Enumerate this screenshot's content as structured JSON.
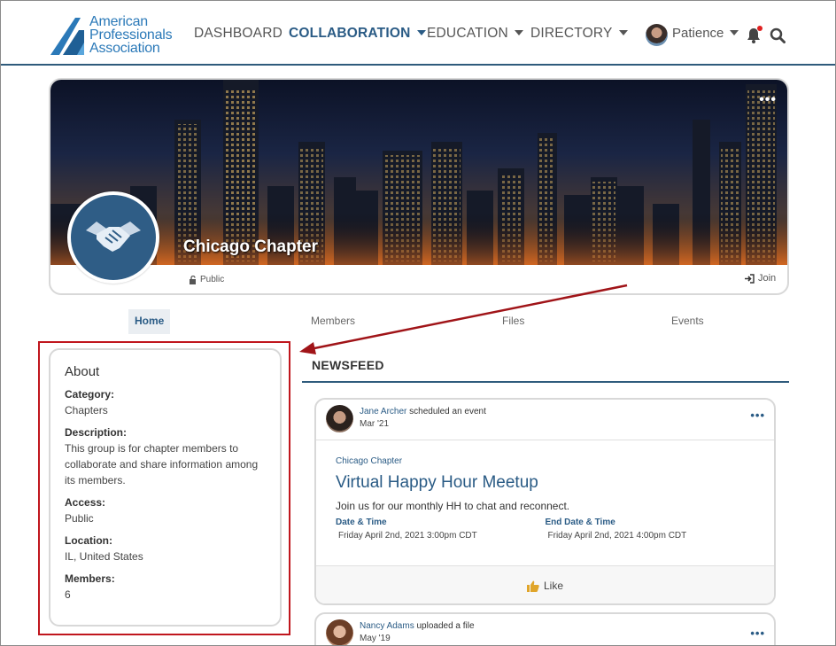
{
  "header": {
    "logo_lines": [
      "American",
      "Professionals",
      "Association"
    ],
    "nav": [
      {
        "label": "DASHBOARD",
        "has_caret": false
      },
      {
        "label": "COLLABORATION",
        "has_caret": true,
        "active": true
      },
      {
        "label": "EDUCATION",
        "has_caret": true
      },
      {
        "label": "DIRECTORY",
        "has_caret": true
      }
    ],
    "user_name": "Patience",
    "icons": [
      "bell-icon",
      "search-icon"
    ]
  },
  "group": {
    "title": "Chicago Chapter",
    "visibility": "Public",
    "join_label": "Join",
    "more_label": "•••"
  },
  "tabs": [
    {
      "label": "Home",
      "active": true
    },
    {
      "label": "Members"
    },
    {
      "label": "Files"
    },
    {
      "label": "Events"
    }
  ],
  "about": {
    "title": "About",
    "fields": [
      {
        "label": "Category:",
        "value": "Chapters"
      },
      {
        "label": "Description:",
        "value": "This group is for chapter members to collaborate and share information among its members."
      },
      {
        "label": "Access:",
        "value": "Public"
      },
      {
        "label": "Location:",
        "value": "IL, United States"
      },
      {
        "label": "Members:",
        "value": "6"
      }
    ]
  },
  "newsfeed": {
    "title": "NEWSFEED",
    "posts": [
      {
        "author": "Jane Archer",
        "action": " scheduled an event",
        "date": "Mar '21",
        "group_link": "Chicago Chapter",
        "event_title": "Virtual Happy Hour Meetup",
        "event_desc": "Join us for our monthly HH to chat and reconnect.",
        "start_label": "Date & Time",
        "start_value": "Friday April 2nd, 2021 3:00pm CDT",
        "end_label": "End Date & Time",
        "end_value": "Friday April 2nd, 2021 4:00pm CDT",
        "like_label": "Like"
      },
      {
        "author": "Nancy Adams",
        "action": " uploaded a file",
        "date": "May '19"
      }
    ]
  },
  "colors": {
    "brand_blue": "#2a5b85",
    "logo_blue": "#2b79b8",
    "highlight_red": "#c0161d"
  }
}
